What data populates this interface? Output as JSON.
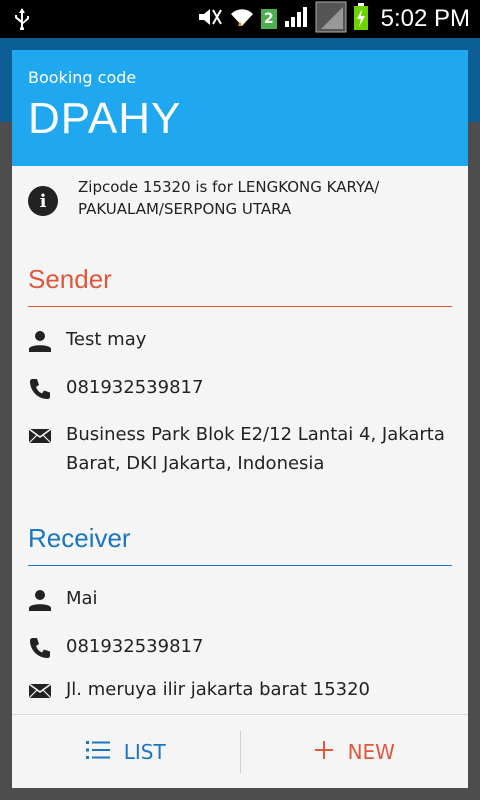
{
  "status_bar": {
    "time": "5:02 PM",
    "sim_badge": "2"
  },
  "dialog": {
    "header_label": "Booking code",
    "booking_code": "DPAHY",
    "info_text": "Zipcode 15320 is for LENGKONG KARYA/ PAKUALAM/SERPONG UTARA",
    "sender": {
      "title": "Sender",
      "name": "Test may",
      "phone": "081932539817",
      "address": "Business Park Blok E2/12 Lantai 4, Jakarta Barat, DKI Jakarta, Indonesia"
    },
    "receiver": {
      "title": "Receiver",
      "name": "Mai",
      "phone": "081932539817",
      "address": "Jl. meruya ilir jakarta barat 15320"
    },
    "actions": {
      "list_label": "LIST",
      "new_label": "NEW"
    }
  },
  "colors": {
    "header_blue": "#1fa7f0",
    "sender_accent": "#e0583c",
    "receiver_accent": "#1a76c0"
  }
}
